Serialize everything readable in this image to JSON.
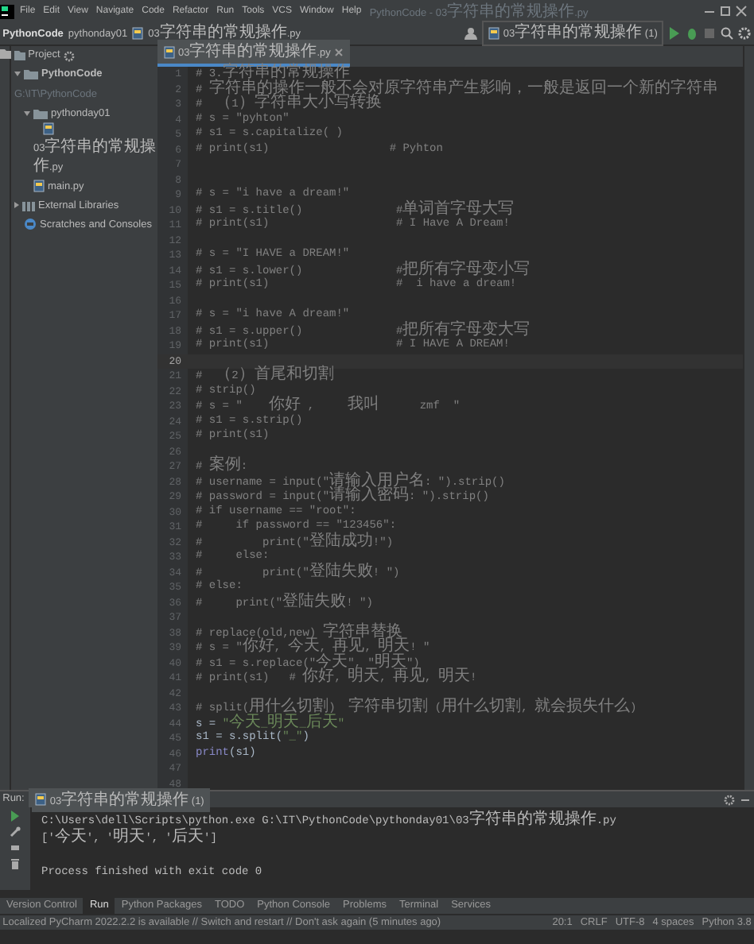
{
  "window": {
    "title": "PythonCode - 03字符串的常规操作.py",
    "menu": [
      "File",
      "Edit",
      "View",
      "Navigate",
      "Code",
      "Refactor",
      "Run",
      "Tools",
      "VCS",
      "Window",
      "Help"
    ]
  },
  "breadcrumbs": [
    "PythonCode",
    "pythonday01",
    "03字符串的常规操作.py"
  ],
  "run_config": "03字符串的常规操作 (1)",
  "project_panel": {
    "title": "Project",
    "tree": [
      {
        "label": "PythonCode",
        "hint": "G:\\IT\\PythonCode",
        "kind": "folder",
        "expanded": true,
        "children": [
          {
            "label": "pythonday01",
            "kind": "folder",
            "expanded": true,
            "children": [
              {
                "label": "03字符串的常规操作.py",
                "kind": "pyfile"
              }
            ]
          },
          {
            "label": "main.py",
            "kind": "pyfile"
          }
        ]
      },
      {
        "label": "External Libraries",
        "kind": "library",
        "expanded": false
      },
      {
        "label": "Scratches and Consoles",
        "kind": "scratch"
      }
    ]
  },
  "editor": {
    "tab": "03字符串的常规操作.py",
    "lines": [
      {
        "number": "1",
        "current": false,
        "tokens": [
          {
            "kind": "comment",
            "text": "# 3.字符串的常规操作"
          }
        ]
      },
      {
        "number": "2",
        "current": false,
        "tokens": [
          {
            "kind": "comment",
            "text": "# 字符串的操作一般不会对原字符串产生影响，一般是返回一个新的字符串"
          }
        ]
      },
      {
        "number": "3",
        "current": false,
        "tokens": [
          {
            "kind": "comment",
            "text": "#  （1）字符串大小写转换"
          }
        ]
      },
      {
        "number": "4",
        "current": false,
        "tokens": [
          {
            "kind": "comment",
            "text": "# s = \"pyhton\""
          }
        ]
      },
      {
        "number": "5",
        "current": false,
        "tokens": [
          {
            "kind": "comment",
            "text": "# s1 = s.capitalize( )"
          }
        ]
      },
      {
        "number": "6",
        "current": false,
        "tokens": [
          {
            "kind": "comment",
            "text": "# print(s1)                  # Pyhton"
          }
        ]
      },
      {
        "number": "7",
        "current": false
      },
      {
        "number": "8",
        "current": false
      },
      {
        "number": "9",
        "current": false,
        "tokens": [
          {
            "kind": "comment",
            "text": "# s = \"i have a dream!\""
          }
        ]
      },
      {
        "number": "10",
        "current": false,
        "tokens": [
          {
            "kind": "comment",
            "text": "# s1 = s.title()              #单词首字母大写"
          }
        ]
      },
      {
        "number": "11",
        "current": false,
        "tokens": [
          {
            "kind": "comment",
            "text": "# print(s1)                   # I Have A Dream!"
          }
        ]
      },
      {
        "number": "12",
        "current": false
      },
      {
        "number": "13",
        "current": false,
        "tokens": [
          {
            "kind": "comment",
            "text": "# s = \"I HAVE a DREAM!\""
          }
        ]
      },
      {
        "number": "14",
        "current": false,
        "tokens": [
          {
            "kind": "comment",
            "text": "# s1 = s.lower()              #把所有字母变小写"
          }
        ]
      },
      {
        "number": "15",
        "current": false,
        "tokens": [
          {
            "kind": "comment",
            "text": "# print(s1)                   #  i have a dream!"
          }
        ]
      },
      {
        "number": "16",
        "current": false
      },
      {
        "number": "17",
        "current": false,
        "tokens": [
          {
            "kind": "comment",
            "text": "# s = \"i have A dream!\""
          }
        ]
      },
      {
        "number": "18",
        "current": false,
        "tokens": [
          {
            "kind": "comment",
            "text": "# s1 = s.upper()              #把所有字母变大写"
          }
        ]
      },
      {
        "number": "19",
        "current": false,
        "tokens": [
          {
            "kind": "comment",
            "text": "# print(s1)                   # I HAVE A DREAM!"
          }
        ]
      },
      {
        "number": "20",
        "current": true
      },
      {
        "number": "21",
        "current": false,
        "tokens": [
          {
            "kind": "comment",
            "text": "#  （2）首尾和切割"
          }
        ]
      },
      {
        "number": "22",
        "current": false,
        "tokens": [
          {
            "kind": "comment",
            "text": "# strip()"
          }
        ]
      },
      {
        "number": "23",
        "current": false,
        "tokens": [
          {
            "kind": "comment",
            "text": "# s = \"    你好 ,     我叫      zmf  \""
          }
        ]
      },
      {
        "number": "24",
        "current": false,
        "tokens": [
          {
            "kind": "comment",
            "text": "# s1 = s.strip()"
          }
        ]
      },
      {
        "number": "25",
        "current": false,
        "tokens": [
          {
            "kind": "comment",
            "text": "# print(s1)"
          }
        ]
      },
      {
        "number": "26",
        "current": false
      },
      {
        "number": "27",
        "current": false,
        "tokens": [
          {
            "kind": "comment",
            "text": "# 案例:"
          }
        ]
      },
      {
        "number": "28",
        "current": false,
        "tokens": [
          {
            "kind": "comment",
            "text": "# username = input(\"请输入用户名: \").strip()"
          }
        ]
      },
      {
        "number": "29",
        "current": false,
        "tokens": [
          {
            "kind": "comment",
            "text": "# password = input(\"请输入密码: \").strip()"
          }
        ]
      },
      {
        "number": "30",
        "current": false,
        "tokens": [
          {
            "kind": "comment",
            "text": "# if username == \"root\":"
          }
        ]
      },
      {
        "number": "31",
        "current": false,
        "tokens": [
          {
            "kind": "comment",
            "text": "#     if password == \"123456\":"
          }
        ]
      },
      {
        "number": "32",
        "current": false,
        "tokens": [
          {
            "kind": "comment",
            "text": "#         print(\"登陆成功!\")"
          }
        ]
      },
      {
        "number": "33",
        "current": false,
        "tokens": [
          {
            "kind": "comment",
            "text": "#     else:"
          }
        ]
      },
      {
        "number": "34",
        "current": false,
        "tokens": [
          {
            "kind": "comment",
            "text": "#         print(\"登陆失败! \")"
          }
        ]
      },
      {
        "number": "35",
        "current": false,
        "tokens": [
          {
            "kind": "comment",
            "text": "# else:"
          }
        ]
      },
      {
        "number": "36",
        "current": false,
        "tokens": [
          {
            "kind": "comment",
            "text": "#     print(\"登陆失败! \")"
          }
        ]
      },
      {
        "number": "37",
        "current": false
      },
      {
        "number": "38",
        "current": false,
        "tokens": [
          {
            "kind": "comment",
            "text": "# replace(old,new) 字符串替换"
          }
        ]
      },
      {
        "number": "39",
        "current": false,
        "tokens": [
          {
            "kind": "comment",
            "text": "# s = \"你好, 今天, 再见, 明天! \""
          }
        ]
      },
      {
        "number": "40",
        "current": false,
        "tokens": [
          {
            "kind": "comment",
            "text": "# s1 = s.replace(\"今天\", \"明天\")"
          }
        ]
      },
      {
        "number": "41",
        "current": false,
        "tokens": [
          {
            "kind": "comment",
            "text": "# print(s1)   # 你好, 明天, 再见, 明天!"
          }
        ]
      },
      {
        "number": "42",
        "current": false
      },
      {
        "number": "43",
        "current": false,
        "tokens": [
          {
            "kind": "comment",
            "text": "# split(用什么切割)  字符串切割 (用什么切割, 就会损失什么)"
          }
        ]
      },
      {
        "number": "44",
        "current": false,
        "tokens": [
          {
            "kind": "code",
            "text": "s = "
          },
          {
            "kind": "string",
            "text": "\"今天_明天_后天\""
          }
        ]
      },
      {
        "number": "45",
        "current": false,
        "tokens": [
          {
            "kind": "code",
            "text": "s1 = s.split("
          },
          {
            "kind": "string",
            "text": "\"_\""
          },
          {
            "kind": "code",
            "text": ")"
          }
        ]
      },
      {
        "number": "46",
        "current": false,
        "tokens": [
          {
            "kind": "builtin",
            "text": "print"
          },
          {
            "kind": "code",
            "text": "(s1)"
          }
        ]
      },
      {
        "number": "47",
        "current": false
      },
      {
        "number": "48",
        "current": false
      }
    ]
  },
  "run_panel": {
    "label": "Run:",
    "tab": "03字符串的常规操作 (1)",
    "output": [
      {
        "kind": "command",
        "text": "C:\\Users\\dell\\Scripts\\python.exe G:\\IT\\PythonCode\\pythonday01\\03字符串的常规操作.py"
      },
      {
        "kind": "output",
        "text": "['今天', '明天', '后天']"
      },
      {
        "kind": "blank"
      },
      {
        "kind": "output",
        "text": "Process finished with exit code 0"
      }
    ]
  },
  "tool_tabs": [
    {
      "label": "Version Control",
      "selected": false
    },
    {
      "label": "Run",
      "selected": true
    },
    {
      "label": "Python Packages",
      "selected": false
    },
    {
      "label": "TODO",
      "selected": false
    },
    {
      "label": "Python Console",
      "selected": false
    },
    {
      "label": "Problems",
      "selected": false
    },
    {
      "label": "Terminal",
      "selected": false
    },
    {
      "label": "Services",
      "selected": false
    }
  ],
  "status_bar": {
    "message": "Localized PyCharm 2022.2.2 is available // Switch and restart // Don't ask again (5 minutes ago)",
    "items": [
      "20:1",
      "CRLF",
      "UTF-8",
      "4 spaces",
      "Python 3.8"
    ]
  }
}
